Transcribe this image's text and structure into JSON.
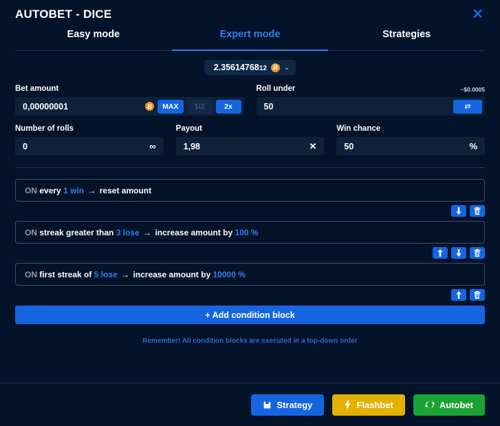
{
  "header": {
    "title": "AUTOBET - DICE",
    "close_icon": "close-icon",
    "close_label": "✕"
  },
  "tabs": [
    {
      "label": "Easy mode",
      "active": false
    },
    {
      "label": "Expert mode",
      "active": true
    },
    {
      "label": "Strategies",
      "active": false
    }
  ],
  "balance": {
    "amount_main": "2.35614768",
    "amount_frac": "12",
    "currency_icon": "bitcoin-icon",
    "currency_symbol": "Ƀ",
    "caret_icon": "chevron-down-icon",
    "caret_glyph": "⌄"
  },
  "fields": {
    "bet_amount": {
      "label": "Bet amount",
      "value": "0,00000001",
      "hint": "",
      "currency_icon": "bitcoin-icon",
      "currency_symbol": "Ƀ",
      "max_label": "MAX",
      "half_label": "1/2",
      "double_label": "2x"
    },
    "roll_under": {
      "label": "Roll under",
      "value": "50",
      "hint": "~$0.0005",
      "swap_icon": "swap-arrows-icon",
      "swap_glyph": "⇄"
    },
    "number_of_rolls": {
      "label": "Number of rolls",
      "value": "0",
      "unit": "∞",
      "unit_icon": "infinity-icon"
    },
    "payout": {
      "label": "Payout",
      "value": "1,98",
      "unit": "✕",
      "unit_icon": "multiply-icon"
    },
    "win_chance": {
      "label": "Win chance",
      "value": "50",
      "unit": "%",
      "unit_icon": "percent-icon"
    }
  },
  "conditions": [
    {
      "prefix": "ON",
      "segments": [
        {
          "text": "every",
          "style": "w"
        },
        {
          "text": "1 win",
          "style": "b"
        },
        {
          "text": "→",
          "style": "arrow"
        },
        {
          "text": "reset amount",
          "style": "w"
        }
      ],
      "actions": [
        {
          "icon": "move-down-icon",
          "name": "move-down-button"
        },
        {
          "icon": "trash-icon",
          "name": "delete-button"
        }
      ]
    },
    {
      "prefix": "ON",
      "segments": [
        {
          "text": "streak greater than",
          "style": "w"
        },
        {
          "text": "3 lose",
          "style": "b"
        },
        {
          "text": "→",
          "style": "arrow"
        },
        {
          "text": "increase amount by",
          "style": "w"
        },
        {
          "text": "100 %",
          "style": "b"
        }
      ],
      "actions": [
        {
          "icon": "move-up-icon",
          "name": "move-up-button"
        },
        {
          "icon": "move-down-icon",
          "name": "move-down-button"
        },
        {
          "icon": "trash-icon",
          "name": "delete-button"
        }
      ]
    },
    {
      "prefix": "ON",
      "segments": [
        {
          "text": "first streak of",
          "style": "w"
        },
        {
          "text": "5 lose",
          "style": "b"
        },
        {
          "text": "→",
          "style": "arrow"
        },
        {
          "text": "increase amount by",
          "style": "w"
        },
        {
          "text": "10000 %",
          "style": "b"
        }
      ],
      "actions": [
        {
          "icon": "move-up-icon",
          "name": "move-up-button"
        },
        {
          "icon": "trash-icon",
          "name": "delete-button"
        }
      ]
    }
  ],
  "add_block_label": "+ Add condition block",
  "remember_note": "Remember! All condition blocks are executed in a top-down order",
  "footer": {
    "strategy_label": "Strategy",
    "strategy_icon": "save-icon",
    "flashbet_label": "Flashbet",
    "flashbet_icon": "lightning-icon",
    "autobet_label": "Autobet",
    "autobet_icon": "refresh-icon"
  },
  "colors": {
    "accent_blue": "#1565e0",
    "tab_blue": "#2f7ff0",
    "bitcoin_orange": "#f7941d",
    "flashbet_yellow": "#e3b100",
    "autobet_green": "#1aa335",
    "modal_bg": "#03132a",
    "input_bg": "#0d2139"
  }
}
